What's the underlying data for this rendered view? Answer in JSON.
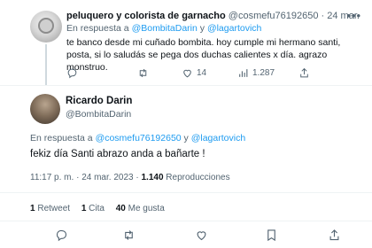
{
  "reply": {
    "name": "peluquero y colorista de garnacho",
    "handle": "@cosmefu76192650",
    "separator": "·",
    "date": "24 mar.",
    "replying_prefix": "En respuesta a",
    "replying_user1": "@BombitaDarin",
    "replying_and": "y",
    "replying_user2": "@lagartovich",
    "text": "te banco desde mi cuñado bombita. hoy cumple mi hermano santi, posta, si lo saludás se pega dos duchas calientes x día. agrazo monstruo.",
    "actions": {
      "reply_count": "",
      "retweet_count": "",
      "like_count": "14",
      "views_count": "1.287"
    }
  },
  "main": {
    "name": "Ricardo Darin",
    "handle": "@BombitaDarin",
    "replying_prefix": "En respuesta a",
    "replying_user1": "@cosmefu76192650",
    "replying_and": "y",
    "replying_user2": "@lagartovich",
    "text": "fekiz día Santi  abrazo  anda a bañarte !",
    "time": "11:17 p. m.",
    "separator": "·",
    "date": "24 mar. 2023",
    "views_count": "1.140",
    "views_label": "Reproducciones"
  },
  "stats": {
    "retweets_count": "1",
    "retweets_label": "Retweet",
    "quotes_count": "1",
    "quotes_label": "Cita",
    "likes_count": "40",
    "likes_label": "Me gusta"
  },
  "colors": {
    "link": "#1d9bf0",
    "secondary_text": "#536471",
    "primary_text": "#0f1419",
    "divider": "#eff3f4"
  },
  "icons": [
    "more-icon",
    "reply-icon",
    "retweet-icon",
    "like-icon",
    "views-icon",
    "share-icon"
  ]
}
